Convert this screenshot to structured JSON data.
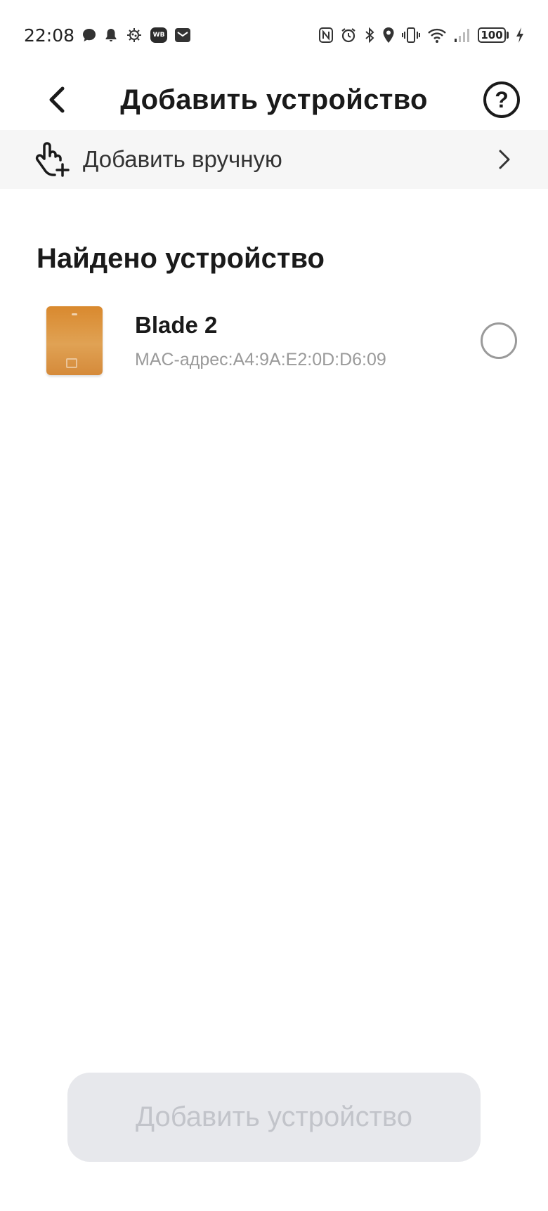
{
  "status_bar": {
    "time": "22:08",
    "battery": "100",
    "left_icons": [
      "message-icon",
      "bell-icon",
      "virus-icon",
      "wb-badge-icon",
      "mail-icon"
    ],
    "right_icons": [
      "nfc-icon",
      "alarm-icon",
      "bluetooth-icon",
      "location-icon",
      "vibrate-icon",
      "wifi-icon",
      "signal-icon",
      "battery-icon",
      "charging-icon"
    ],
    "wb_label": "WB"
  },
  "header": {
    "title": "Добавить устройство",
    "help_symbol": "?"
  },
  "manual_add": {
    "label": "Добавить вручную"
  },
  "found": {
    "section_title": "Найдено устройство",
    "devices": [
      {
        "name": "Blade 2",
        "mac": "MAC-адрес:A4:9A:E2:0D:D6:09",
        "selected": false
      }
    ]
  },
  "footer": {
    "add_button_label": "Добавить устройство",
    "add_button_enabled": false
  },
  "colors": {
    "background": "#ffffff",
    "manual_row_bg": "#f6f6f6",
    "button_disabled_bg": "#e7e8ec",
    "button_disabled_text": "#c2c4ca",
    "device_accent": "#dd9640"
  }
}
